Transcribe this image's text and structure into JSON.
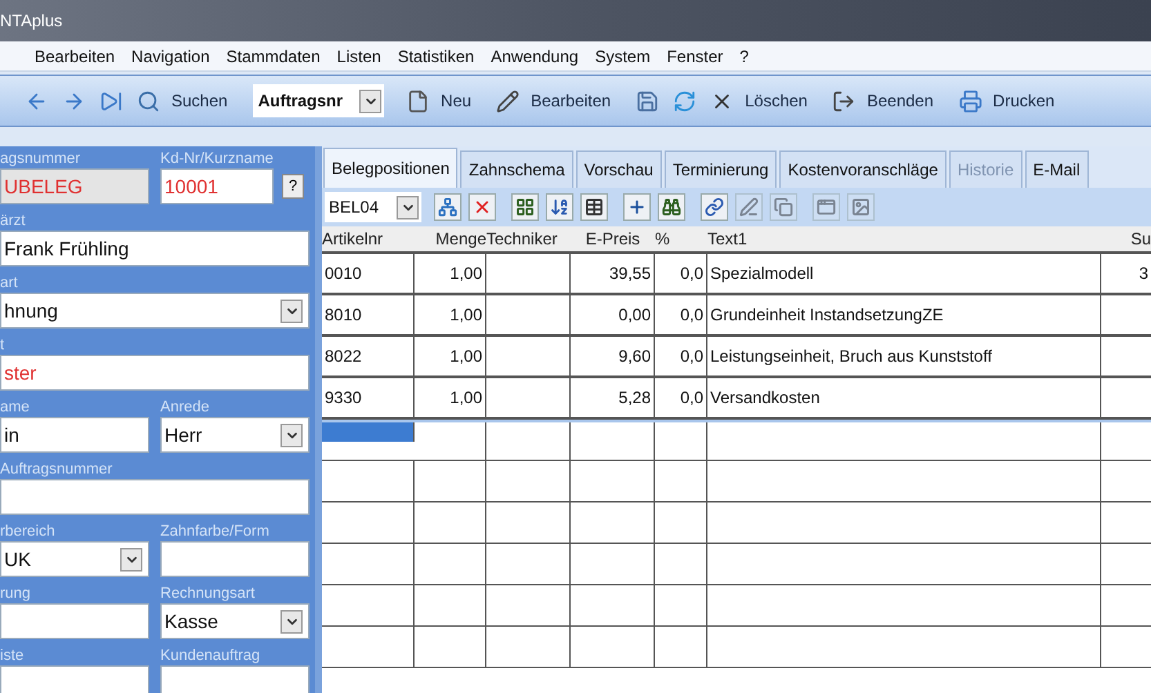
{
  "window": {
    "title": "NTAplus"
  },
  "menu": [
    "Bearbeiten",
    "Navigation",
    "Stammdaten",
    "Listen",
    "Statistiken",
    "Anwendung",
    "System",
    "Fenster",
    "?"
  ],
  "toolbar": [
    {
      "kind": "icon"
    },
    {
      "kind": "icon"
    },
    {
      "kind": "icon"
    },
    {
      "kind": "button",
      "label": "Suchen"
    },
    {
      "kind": "combo",
      "value": "Auftragsnr"
    },
    {
      "kind": "button",
      "label": "Neu"
    },
    {
      "kind": "button",
      "label": "Bearbeiten"
    },
    {
      "kind": "icon"
    },
    {
      "kind": "icon"
    },
    {
      "kind": "button",
      "label": "Löschen"
    },
    {
      "kind": "button",
      "label": "Beenden"
    },
    {
      "kind": "button",
      "label": "Drucken"
    }
  ],
  "form": {
    "rows": [
      {
        "fields": [
          {
            "label": "agsnummer",
            "value": "UBELEG",
            "kind": "text",
            "color": "#e03131",
            "disabled": true
          },
          {
            "label": "Kd-Nr/Kurzname",
            "value": "10001",
            "kind": "text",
            "color": "#e03131",
            "disabled": false,
            "button": "?"
          }
        ]
      },
      {
        "fields": [
          {
            "label": "ärzt",
            "value": "Frank Frühling",
            "kind": "text",
            "color": "#111111",
            "disabled": false
          }
        ]
      },
      {
        "fields": [
          {
            "label": "art",
            "value": "hnung",
            "kind": "dropdown",
            "color": "#111111",
            "disabled": false
          }
        ]
      },
      {
        "fields": [
          {
            "label": "t",
            "value": "ster",
            "kind": "text",
            "color": "#e03131",
            "disabled": false
          }
        ]
      },
      {
        "fields": [
          {
            "label": "ame",
            "value": "in",
            "kind": "text",
            "color": "#111111",
            "disabled": false
          },
          {
            "label": "Anrede",
            "value": "Herr",
            "kind": "dropdown",
            "color": "#111111",
            "disabled": false
          }
        ]
      },
      {
        "fields": [
          {
            "label": "Auftragsnummer",
            "kind": "text",
            "disabled": false
          }
        ]
      },
      {
        "fields": [
          {
            "label": "rbereich",
            "value": "UK",
            "kind": "dropdown",
            "color": "#111111",
            "disabled": false
          },
          {
            "label": "Zahnfarbe/Form",
            "kind": "text",
            "disabled": false
          }
        ]
      },
      {
        "fields": [
          {
            "label": "rung",
            "kind": "text",
            "disabled": false
          },
          {
            "label": "Rechnungsart",
            "value": "Kasse",
            "kind": "dropdown",
            "color": "#111111",
            "disabled": false
          }
        ]
      },
      {
        "fields": [
          {
            "label": "iste",
            "kind": "text",
            "disabled": false
          },
          {
            "label": "Kundenauftrag",
            "kind": "text",
            "disabled": false
          }
        ]
      }
    ]
  },
  "tabs": [
    {
      "label": "Belegpositionen",
      "selected": true,
      "disabled": false
    },
    {
      "label": "Zahnschema",
      "selected": false,
      "disabled": false
    },
    {
      "label": "Vorschau",
      "selected": false,
      "disabled": false
    },
    {
      "label": "Terminierung",
      "selected": false,
      "disabled": false
    },
    {
      "label": "Kostenvoranschläge",
      "selected": false,
      "disabled": false
    },
    {
      "label": "Historie",
      "selected": false,
      "disabled": true
    },
    {
      "label": "E-Mail",
      "selected": false,
      "disabled": false
    }
  ],
  "subtoolbar": {
    "combo": "BEL04",
    "icons": [
      {
        "disabled": false
      },
      {
        "disabled": false
      },
      {
        "disabled": false
      },
      {
        "disabled": false
      },
      {
        "disabled": false
      },
      {
        "disabled": false
      },
      {
        "disabled": false
      },
      {
        "disabled": false
      },
      {
        "disabled": true
      },
      {
        "disabled": true
      },
      {
        "disabled": true
      },
      {
        "disabled": true
      }
    ]
  },
  "table": {
    "columns": [
      "Artikelnr",
      "Menge",
      "Techniker",
      "E-Preis",
      "%",
      "Text1",
      "Su"
    ],
    "rows": [
      [
        "0010",
        "1,00",
        "",
        "39,55",
        "0,0",
        "Spezialmodell",
        "3"
      ],
      [
        "8010",
        "1,00",
        "",
        "0,00",
        "0,0",
        "Grundeinheit InstandsetzungZE",
        ""
      ],
      [
        "8022",
        "1,00",
        "",
        "9,60",
        "0,0",
        "Leistungseinheit, Bruch aus Kunststoff",
        ""
      ],
      [
        "9330",
        "1,00",
        "",
        "5,28",
        "0,0",
        "Versandkosten",
        ""
      ]
    ],
    "new_row": {
      "selected": true
    }
  }
}
